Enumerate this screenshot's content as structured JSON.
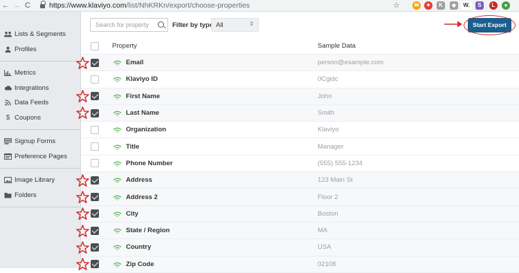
{
  "browser": {
    "back": "←",
    "forward": "→",
    "reload": "C",
    "url_host": "https://www.klaviyo.com",
    "url_path": "/list/NhKRKn/export/choose-properties",
    "bookmark": "☆",
    "extensions": [
      "✉",
      "✦",
      "K",
      "◆",
      "W.",
      "S",
      "L",
      "●"
    ]
  },
  "sidebar": {
    "groups": [
      [
        {
          "label": "Lists & Segments",
          "icon": "people-icon"
        },
        {
          "label": "Profiles",
          "icon": "person-icon"
        }
      ],
      [
        {
          "label": "Metrics",
          "icon": "bar-chart-icon"
        },
        {
          "label": "Integrations",
          "icon": "cloud-icon"
        },
        {
          "label": "Data Feeds",
          "icon": "rss-icon"
        },
        {
          "label": "Coupons",
          "icon": "dollar-icon"
        }
      ],
      [
        {
          "label": "Signup Forms",
          "icon": "form-icon"
        },
        {
          "label": "Preference Pages",
          "icon": "page-icon"
        }
      ],
      [
        {
          "label": "Image Library",
          "icon": "image-icon"
        },
        {
          "label": "Folders",
          "icon": "folder-icon"
        }
      ]
    ]
  },
  "toolbar": {
    "search_placeholder": "Search for property",
    "filter_label": "Filter by type:",
    "filter_value": "All",
    "export_label": "Start Export"
  },
  "table": {
    "col_property": "Property",
    "col_sample": "Sample Data",
    "rows": [
      {
        "property": "Email",
        "sample": "person@example.com",
        "checked": true,
        "starred": true
      },
      {
        "property": "Klaviyo ID",
        "sample": "0Cgidc",
        "checked": false,
        "starred": false
      },
      {
        "property": "First Name",
        "sample": "John",
        "checked": true,
        "starred": true
      },
      {
        "property": "Last Name",
        "sample": "Smith",
        "checked": true,
        "starred": true
      },
      {
        "property": "Organization",
        "sample": "Klaviyo",
        "checked": false,
        "starred": false
      },
      {
        "property": "Title",
        "sample": "Manager",
        "checked": false,
        "starred": false
      },
      {
        "property": "Phone Number",
        "sample": "(555) 555-1234",
        "checked": false,
        "starred": false
      },
      {
        "property": "Address",
        "sample": "123 Main St",
        "checked": true,
        "starred": true
      },
      {
        "property": "Address 2",
        "sample": "Floor 2",
        "checked": true,
        "starred": true
      },
      {
        "property": "City",
        "sample": "Boston",
        "checked": true,
        "starred": true
      },
      {
        "property": "State / Region",
        "sample": "MA",
        "checked": true,
        "starred": true
      },
      {
        "property": "Country",
        "sample": "USA",
        "checked": true,
        "starred": true
      },
      {
        "property": "Zip Code",
        "sample": "02108",
        "checked": true,
        "starred": true
      }
    ]
  },
  "colors": {
    "accent": "#1a5f8e",
    "annotation": "#d82a2a",
    "property_icon": "#5cb85c"
  }
}
